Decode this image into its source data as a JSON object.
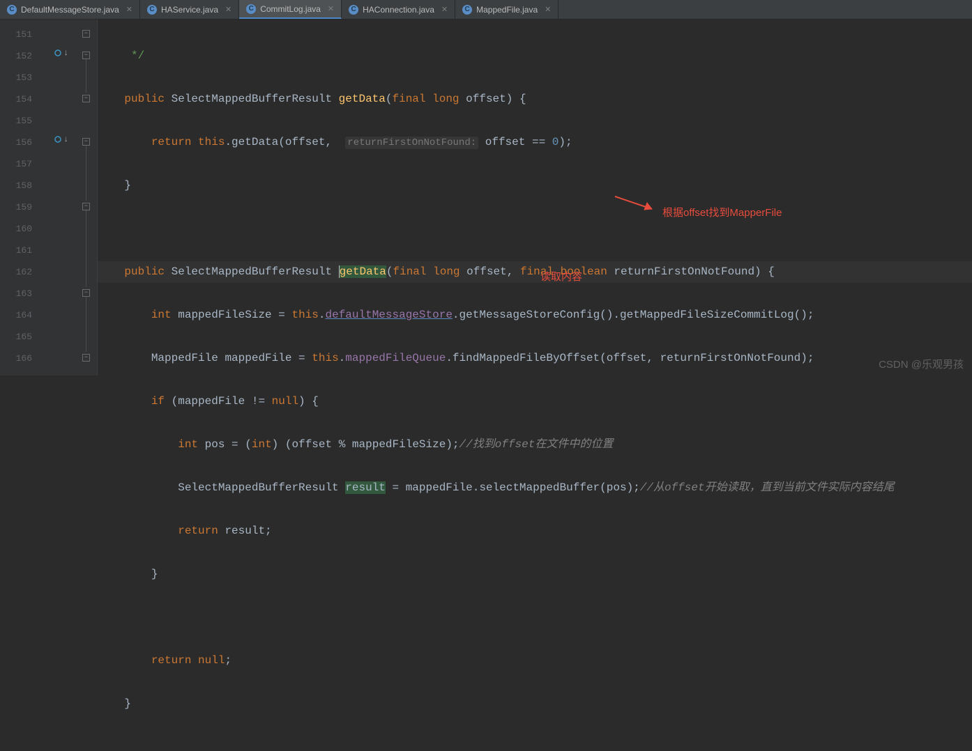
{
  "tabs": [
    {
      "label": "DefaultMessageStore.java",
      "active": false
    },
    {
      "label": "HAService.java",
      "active": false
    },
    {
      "label": "CommitLog.java",
      "active": true
    },
    {
      "label": "HAConnection.java",
      "active": false
    },
    {
      "label": "MappedFile.java",
      "active": false
    }
  ],
  "line_numbers": [
    "151",
    "152",
    "153",
    "154",
    "155",
    "156",
    "157",
    "158",
    "159",
    "160",
    "161",
    "162",
    "163",
    "164",
    "165",
    "166"
  ],
  "tokens": {
    "comment_end": "*/",
    "public": "public",
    "return_kw": "return",
    "this_kw": "this",
    "final_kw": "final",
    "long_kw": "long",
    "boolean_kw": "boolean",
    "int_kw": "int",
    "null_kw": "null",
    "if_kw": "if",
    "SelectMappedBufferResult": "SelectMappedBufferResult",
    "getData": "getData",
    "offset": "offset",
    "returnFirstOnNotFound": "returnFirstOnNotFound",
    "hint_label": "returnFirstOnNotFound:",
    "mappedFileSize": "mappedFileSize",
    "defaultMessageStore": "defaultMessageStore",
    "getMessageStoreConfig": "getMessageStoreConfig",
    "getMappedFileSizeCommitLog": "getMappedFileSizeCommitLog",
    "MappedFile": "MappedFile",
    "mappedFile": "mappedFile",
    "mappedFileQueue": "mappedFileQueue",
    "findMappedFileByOffset": "findMappedFileByOffset",
    "pos": "pos",
    "result": "result",
    "selectMappedBuffer": "selectMappedBuffer",
    "zero": "0",
    "comment1": "//找到offset在文件中的位置",
    "comment2": "//从offset开始读取，直到当前文件实际内容结尾"
  },
  "annotations": {
    "a1": "根据offset找到MapperFile",
    "a2": "读取内容"
  },
  "watermark": "CSDN @乐观男孩"
}
